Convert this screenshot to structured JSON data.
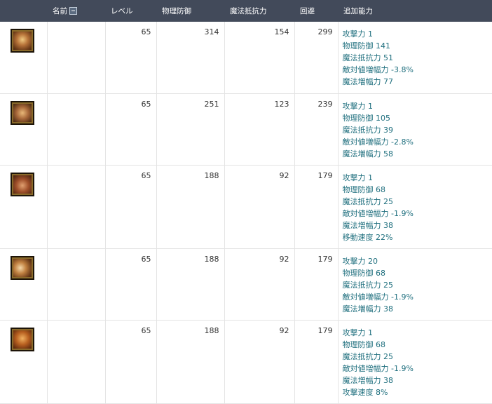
{
  "columns": {
    "name": "名前",
    "level": "レベル",
    "physical_defense": "物理防御",
    "magic_resistance": "魔法抵抗力",
    "evasion": "回避",
    "bonus": "追加能力"
  },
  "icons": {
    "collapse_toggle": "minus-box-icon",
    "item": "armor-icon"
  },
  "colors": {
    "header_bg": "#424a5a",
    "bonus_text": "#1f6f7e"
  },
  "rows": [
    {
      "name": "",
      "level": "65",
      "physical_defense": "314",
      "magic_resistance": "154",
      "evasion": "299",
      "bonus": [
        "攻撃力 1",
        "物理防御 141",
        "魔法抵抗力 51",
        "敵対値増幅力 -3.8%",
        "魔法増幅力 77"
      ]
    },
    {
      "name": "",
      "level": "65",
      "physical_defense": "251",
      "magic_resistance": "123",
      "evasion": "239",
      "bonus": [
        "攻撃力 1",
        "物理防御 105",
        "魔法抵抗力 39",
        "敵対値増幅力 -2.8%",
        "魔法増幅力 58"
      ]
    },
    {
      "name": "",
      "level": "65",
      "physical_defense": "188",
      "magic_resistance": "92",
      "evasion": "179",
      "bonus": [
        "攻撃力 1",
        "物理防御 68",
        "魔法抵抗力 25",
        "敵対値増幅力 -1.9%",
        "魔法増幅力 38",
        "移動速度 22%"
      ]
    },
    {
      "name": "",
      "level": "65",
      "physical_defense": "188",
      "magic_resistance": "92",
      "evasion": "179",
      "bonus": [
        "攻撃力 20",
        "物理防御 68",
        "魔法抵抗力 25",
        "敵対値増幅力 -1.9%",
        "魔法増幅力 38"
      ]
    },
    {
      "name": "",
      "level": "65",
      "physical_defense": "188",
      "magic_resistance": "92",
      "evasion": "179",
      "bonus": [
        "攻撃力 1",
        "物理防御 68",
        "魔法抵抗力 25",
        "敵対値増幅力 -1.9%",
        "魔法増幅力 38",
        "攻撃速度 8%"
      ]
    }
  ]
}
